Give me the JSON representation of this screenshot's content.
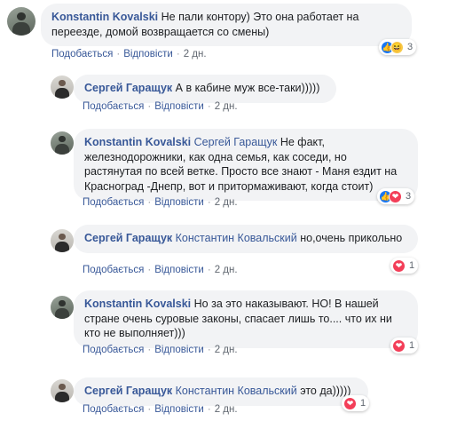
{
  "actions": {
    "like": "Подобається",
    "reply": "Відповісти"
  },
  "comments": [
    {
      "author": "Konstantin Kovalski",
      "text": "Не пали контору) Это она работает на переезде, домой возвращается со смены)",
      "mention": "",
      "time": "2 дн.",
      "reactions": {
        "types": [
          "like",
          "haha"
        ],
        "count": "3"
      }
    },
    {
      "author": "Сергей Гаращук",
      "text": "А в кабине муж все-таки)))))",
      "mention": "",
      "time": "2 дн.",
      "reactions": null
    },
    {
      "author": "Konstantin Kovalski",
      "mention": "Сергей Гаращук",
      "text": "Не факт, железнодорожники, как одна семья, как соседи, но растянутая по всей ветке. Просто все знают - Маня ездит на Красноград -Днепр, вот и притормаживают, когда стоит)",
      "time": "2 дн.",
      "reactions": {
        "types": [
          "like",
          "love"
        ],
        "count": "3"
      }
    },
    {
      "author": "Сергей Гаращук",
      "mention": "Константин Ковальский",
      "text": "но,очень прикольно",
      "time": "2 дн.",
      "reactions": {
        "types": [
          "love"
        ],
        "count": "1"
      }
    },
    {
      "author": "Konstantin Kovalski",
      "mention": "",
      "text": "Но за это наказывают. НО! В нашей стране очень суровые законы, спасает лишь то.... что их ни кто не выполняет)))",
      "time": "2 дн.",
      "reactions": {
        "types": [
          "love"
        ],
        "count": "1"
      }
    },
    {
      "author": "Сергей Гаращук",
      "mention": "Константин Ковальский",
      "text": "это да)))))",
      "time": "2 дн.",
      "reactions": {
        "types": [
          "love"
        ],
        "count": "1"
      }
    }
  ],
  "colors": {
    "author": "#385898",
    "bubble": "#f2f3f5",
    "like": "#1877f2",
    "love": "#f33e58",
    "haha": "#f7c948"
  }
}
